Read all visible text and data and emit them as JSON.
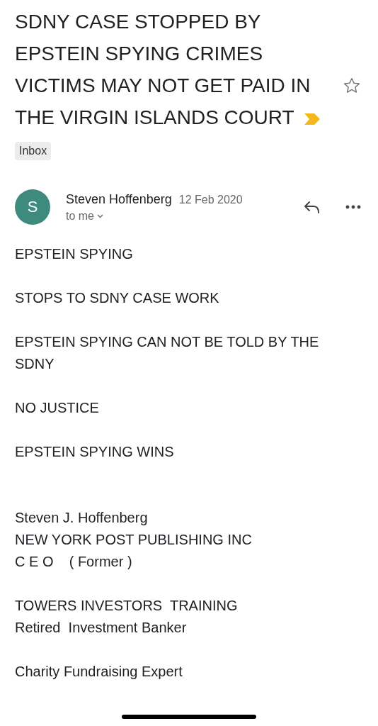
{
  "subject": "SDNY CASE STOPPED BY EPSTEIN SPYING CRIMES VICTIMS MAY NOT GET PAID IN THE VIRGIN ISLANDS COURT",
  "important": true,
  "label": "Inbox",
  "starred": false,
  "sender": {
    "initial": "S",
    "name": "Steven Hoffenberg",
    "date": "12 Feb 2020",
    "recipient": "to me"
  },
  "body": [
    {
      "kind": "text",
      "lines": [
        "EPSTEIN SPYING"
      ]
    },
    {
      "kind": "text",
      "lines": [
        "STOPS TO SDNY CASE WORK"
      ]
    },
    {
      "kind": "text",
      "lines": [
        "EPSTEIN SPYING CAN NOT BE TOLD BY THE SDNY"
      ]
    },
    {
      "kind": "text",
      "lines": [
        "NO JUSTICE"
      ]
    },
    {
      "kind": "text",
      "lines": [
        "EPSTEIN SPYING WINS"
      ]
    },
    {
      "kind": "signature",
      "lines": [
        "Steven J. Hoffenberg",
        "NEW YORK POST PUBLISHING INC",
        "C E O    ( Former )"
      ]
    },
    {
      "kind": "text",
      "lines": [
        "TOWERS INVESTORS  TRAINING",
        "Retired  Investment Banker"
      ]
    },
    {
      "kind": "text",
      "lines": [
        "Charity Fundraising Expert"
      ]
    }
  ]
}
